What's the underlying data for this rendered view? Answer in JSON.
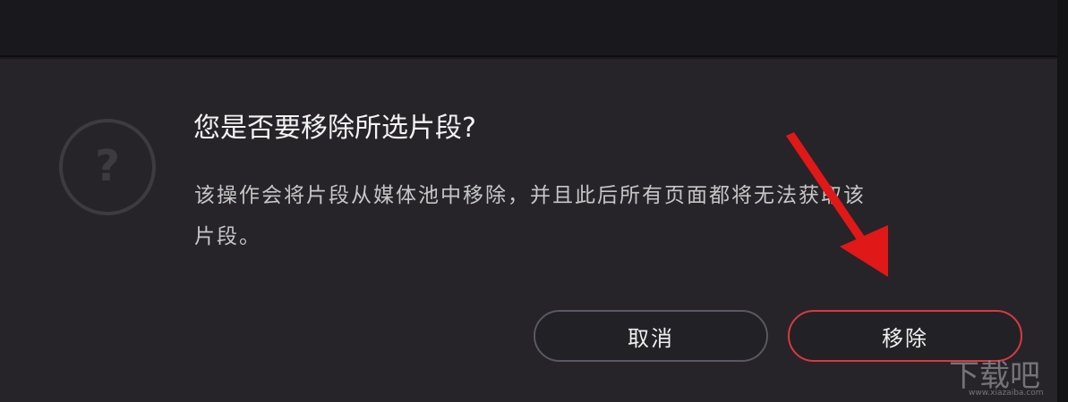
{
  "dialog": {
    "title": "您是否要移除所选片段?",
    "message_line1": "该操作会将片段从媒体池中移除，并且此后所有页面都将无法获取该",
    "message_line2": "片段。",
    "icon": "question-icon",
    "buttons": {
      "cancel_label": "取消",
      "remove_label": "移除"
    }
  },
  "colors": {
    "background": "#262429",
    "cancel_border": "#5a5860",
    "remove_border": "#d83a3f",
    "annotation_arrow": "#e01818"
  },
  "watermark": {
    "brand": "下载吧",
    "url": "www.xiazaiba.com"
  }
}
